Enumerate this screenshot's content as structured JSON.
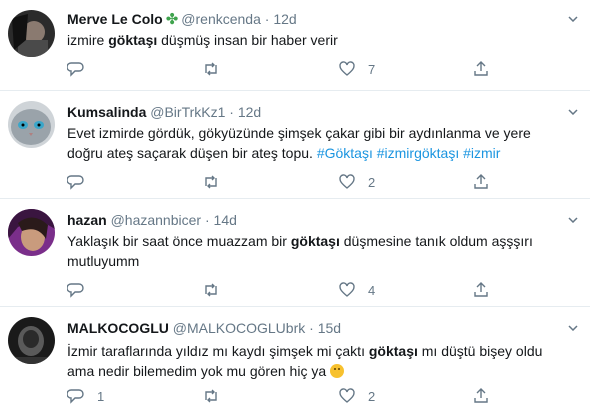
{
  "tweets": [
    {
      "name": "Merve Le Colo",
      "name_icon": "four-leaf-clover",
      "handle": "@renkcenda",
      "dot": "·",
      "time": "12d",
      "text_parts": [
        "izmire ",
        "göktaşı",
        " düşmüş insan bir haber verir"
      ],
      "reply_count": "",
      "retweet_count": "",
      "like_count": "7"
    },
    {
      "name": "Kumsalinda",
      "handle": "@BirTrkKz1",
      "dot": "·",
      "time": "12d",
      "text_line1": "Evet izmirde gördük, gökyüzünde şimşek çakar gibi bir aydınlanma ve yere",
      "text_line2": "doğru ateş saçarak düşen bir ateş topu.",
      "hashtags": [
        "#Göktaşı",
        "#izmirgöktaşı",
        "#izmir"
      ],
      "reply_count": "",
      "retweet_count": "",
      "like_count": "2"
    },
    {
      "name": "hazan",
      "handle": "@hazannbicer",
      "dot": "·",
      "time": "14d",
      "text_parts": [
        "Yaklaşık bir saat önce muazzam bir ",
        "göktaşı",
        " düşmesine tanık oldum aşşşırı"
      ],
      "text_line2": "mutluyumm",
      "reply_count": "",
      "retweet_count": "",
      "like_count": "4"
    },
    {
      "name": "MALKOCOGLU",
      "handle": "@MALKOCOGLUbrk",
      "dot": "·",
      "time": "15d",
      "text_parts": [
        "İzmir taraflarında yıldız mı kaydı şimşek mi çaktı ",
        "göktaşı",
        " mı düştü bişey oldu"
      ],
      "text_line2": "ama nedir bilemedim yok mu gören hiç ya",
      "emoji": "thinking-face",
      "reply_count": "1",
      "retweet_count": "",
      "like_count": "2"
    }
  ],
  "colors": {
    "text": "#14171a",
    "secondary": "#657786",
    "link": "#1b95e0",
    "divider": "#e6ecf0"
  }
}
